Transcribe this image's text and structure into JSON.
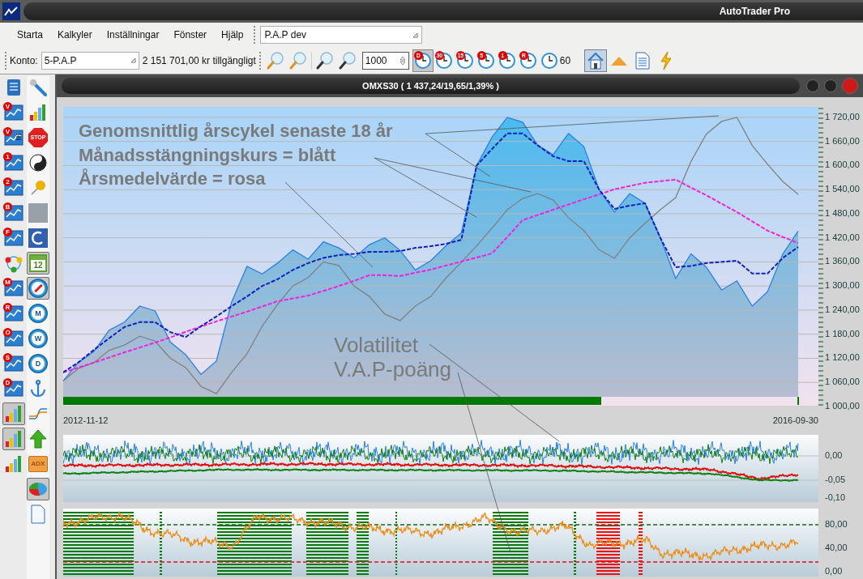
{
  "window": {
    "title": "AutoTrader Pro"
  },
  "menu": [
    "Starta",
    "Kalkyler",
    "Inställningar",
    "Fönster",
    "Hjälp"
  ],
  "workspace": {
    "value": "P.A.P dev"
  },
  "toolbar": {
    "account_label": "Konto:",
    "account": "5-P.A.P",
    "available": "2 151 701,00 kr tillgängligt",
    "bar_count": "1000",
    "intervals": [
      {
        "badge": "D",
        "selected": true
      },
      {
        "badge": "30",
        "selected": false
      },
      {
        "badge": "15",
        "selected": false
      },
      {
        "badge": "5",
        "selected": false
      },
      {
        "badge": "1",
        "selected": false
      },
      {
        "badge": "R",
        "selected": false
      },
      {
        "label": "60",
        "selected": false
      }
    ],
    "tools": [
      {
        "kind": "home",
        "selected": true
      },
      {
        "kind": "triangle",
        "selected": false
      },
      {
        "kind": "document",
        "selected": false
      },
      {
        "kind": "lightning",
        "selected": false
      }
    ]
  },
  "sidebar": {
    "left": [
      {
        "kind": "scroll",
        "selected": false
      },
      {
        "kind": "chart",
        "badge": "V",
        "selected": false
      },
      {
        "kind": "chart_list",
        "badge": "V",
        "selected": false
      },
      {
        "kind": "chart",
        "badge": "1",
        "selected": false
      },
      {
        "kind": "chart",
        "badge": "2",
        "selected": false
      },
      {
        "kind": "chart",
        "badge": "B",
        "selected": false
      },
      {
        "kind": "chart",
        "badge": "F",
        "selected": false
      },
      {
        "kind": "cycle",
        "selected": false
      },
      {
        "kind": "chart",
        "badge": "M",
        "selected": false
      },
      {
        "kind": "chart",
        "badge": "R",
        "selected": false
      },
      {
        "kind": "chart",
        "badge": "O",
        "selected": false
      },
      {
        "kind": "chart",
        "badge": "S",
        "selected": false
      },
      {
        "kind": "chart",
        "badge": "D",
        "selected": false
      },
      {
        "kind": "bars",
        "selected": true
      },
      {
        "kind": "bars",
        "selected": true
      },
      {
        "kind": "bars",
        "selected": false
      }
    ],
    "right": [
      {
        "kind": "wrench",
        "selected": false
      },
      {
        "kind": "bars",
        "selected": false
      },
      {
        "kind": "stop",
        "label": "STOP",
        "selected": false
      },
      {
        "kind": "yinyang",
        "selected": false
      },
      {
        "kind": "pin",
        "selected": false
      },
      {
        "kind": "photo",
        "selected": false
      },
      {
        "kind": "swirl",
        "selected": false
      },
      {
        "kind": "calendar",
        "label": "12",
        "selected": true
      },
      {
        "kind": "compass",
        "selected": true
      },
      {
        "kind": "compass",
        "label": "M",
        "selected": false
      },
      {
        "kind": "compass",
        "label": "W",
        "selected": false
      },
      {
        "kind": "compass",
        "label": "D",
        "selected": false
      },
      {
        "kind": "anchor",
        "selected": false
      },
      {
        "kind": "curve",
        "selected": false
      },
      {
        "kind": "arrow",
        "selected": false
      },
      {
        "kind": "folder",
        "label": "ADX",
        "selected": false
      },
      {
        "kind": "pie",
        "selected": true
      },
      {
        "kind": "document",
        "selected": false
      }
    ]
  },
  "chart": {
    "title": "OMXS30 ( 1 437,24/19,65/1,39% )",
    "chart_data": {
      "type": "line",
      "grid": true,
      "categories": [
        null,
        null,
        null,
        null,
        null,
        null,
        null,
        null,
        null,
        null,
        null,
        null,
        null,
        null,
        null,
        null,
        null,
        null,
        null,
        null,
        null,
        null,
        null,
        null,
        null,
        null,
        null,
        null,
        null,
        null,
        null,
        null,
        null,
        null,
        null,
        null,
        null,
        null,
        null,
        null,
        null,
        null,
        null,
        null,
        null,
        null,
        null,
        null,
        null
      ],
      "ylim": [
        1000,
        1746
      ],
      "yticks": [
        {
          "value": 1720,
          "label": "1 720,00"
        },
        {
          "value": 1660,
          "label": "1 660,00"
        },
        {
          "value": 1600,
          "label": "1 600,00"
        },
        {
          "value": 1540,
          "label": "1 540,00"
        },
        {
          "value": 1480,
          "label": "1 480,00"
        },
        {
          "value": 1420,
          "label": "1 420,00"
        },
        {
          "value": 1360,
          "label": "1 360,00"
        },
        {
          "value": 1300,
          "label": "1 300,00"
        },
        {
          "value": 1240,
          "label": "1 240,00"
        },
        {
          "value": 1180,
          "label": "1 180,00"
        },
        {
          "value": 1120,
          "label": "1 120,00"
        },
        {
          "value": 1060,
          "label": "1 060,00"
        },
        {
          "value": 1000,
          "label": "1 000,00"
        }
      ],
      "series": [
        {
          "color": "#2a7fe8",
          "values": [
            1064,
            1110,
            1137,
            1190,
            1210,
            1250,
            1238,
            1160,
            1129,
            1080,
            1113,
            1260,
            1349,
            1330,
            1357,
            1390,
            1367,
            1410,
            1395,
            1370,
            1403,
            1420,
            1389,
            1340,
            1363,
            1400,
            1432,
            1600,
            1670,
            1720,
            1708,
            1650,
            1627,
            1680,
            1647,
            1540,
            1484,
            1530,
            1506,
            1420,
            1319,
            1380,
            1347,
            1290,
            1313,
            1250,
            1286,
            1380,
            1437
          ]
        },
        {
          "color": "#808080",
          "values": [
            1064,
            1095,
            1109,
            1140,
            1153,
            1175,
            1163,
            1120,
            1097,
            1050,
            1032,
            1085,
            1131,
            1200,
            1254,
            1300,
            1321,
            1360,
            1351,
            1300,
            1274,
            1230,
            1214,
            1250,
            1274,
            1320,
            1359,
            1400,
            1444,
            1490,
            1518,
            1530,
            1514,
            1470,
            1438,
            1390,
            1369,
            1420,
            1456,
            1490,
            1520,
            1610,
            1678,
            1710,
            1720,
            1650,
            1603,
            1560,
            1528
          ]
        },
        {
          "color": "#f020e0",
          "line_style": "dashed",
          "values": [
            1085,
            1097,
            1109,
            1122,
            1135,
            1147,
            1159,
            1172,
            1186,
            1199,
            1212,
            1224,
            1236,
            1249,
            1262,
            1269,
            1276,
            1288,
            1300,
            1313,
            1327,
            1327,
            1325,
            1333,
            1341,
            1351,
            1361,
            1371,
            1381,
            1422,
            1464,
            1477,
            1490,
            1503,
            1516,
            1528,
            1541,
            1549,
            1557,
            1561,
            1565,
            1545,
            1526,
            1505,
            1484,
            1461,
            1438,
            1422,
            1407
          ]
        },
        {
          "color": "#1020c0",
          "line_style": "dashed",
          "values": [
            1085,
            1110,
            1141,
            1170,
            1198,
            1210,
            1210,
            1185,
            1173,
            1200,
            1224,
            1250,
            1274,
            1300,
            1317,
            1340,
            1357,
            1370,
            1377,
            1380,
            1385,
            1385,
            1387,
            1395,
            1399,
            1405,
            1415,
            1600,
            1641,
            1680,
            1680,
            1650,
            1623,
            1611,
            1611,
            1540,
            1492,
            1500,
            1506,
            1420,
            1347,
            1350,
            1357,
            1360,
            1363,
            1331,
            1331,
            1370,
            1397
          ]
        }
      ]
    },
    "date_start": "2012-11-12",
    "date_end": "2016-09-30",
    "annotations": [
      {
        "text": "Genomsnittlig årscykel senaste 18 år",
        "kind": "bold"
      },
      {
        "text": "Månadsstängningskurs = blått",
        "kind": "bold"
      },
      {
        "text": "Årsmedelvärde = rosa",
        "kind": "bold"
      },
      {
        "text": "Volatilitet",
        "kind": "plain"
      },
      {
        "text": "V.A.P-poäng",
        "kind": "plain"
      }
    ]
  },
  "volatility_panel": {
    "y_labels": [
      "0,00",
      "-0,05",
      "-0,10"
    ]
  },
  "score_panel": {
    "y_labels": [
      "80,00",
      "40,00",
      "0,00"
    ]
  }
}
